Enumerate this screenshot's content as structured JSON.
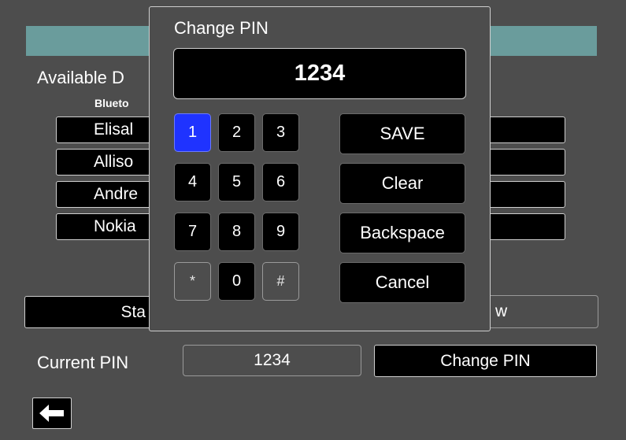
{
  "background_screen": {
    "available_label": "Available D",
    "bluetooth_label": "Blueto",
    "devices": [
      "Elisal",
      "Alliso",
      "Andre",
      "Nokia"
    ],
    "start_label": "Sta",
    "right_button_fragment": "w",
    "current_pin_label": "Current PIN",
    "current_pin_value": "1234",
    "change_pin_button": "Change PIN",
    "back_icon": "arrow-left-icon"
  },
  "dialog": {
    "title": "Change PIN",
    "pin_value": "1234",
    "keys": [
      "1",
      "2",
      "3",
      "4",
      "5",
      "6",
      "7",
      "8",
      "9",
      "*",
      "0",
      "#"
    ],
    "selected_key": "1",
    "actions": {
      "save": "SAVE",
      "clear": "Clear",
      "backspace": "Backspace",
      "cancel": "Cancel"
    }
  },
  "colors": {
    "background": "#4d4d4d",
    "teal_bar": "#6a9c9c",
    "selected_key": "#1f33ff",
    "button_black": "#000000"
  }
}
